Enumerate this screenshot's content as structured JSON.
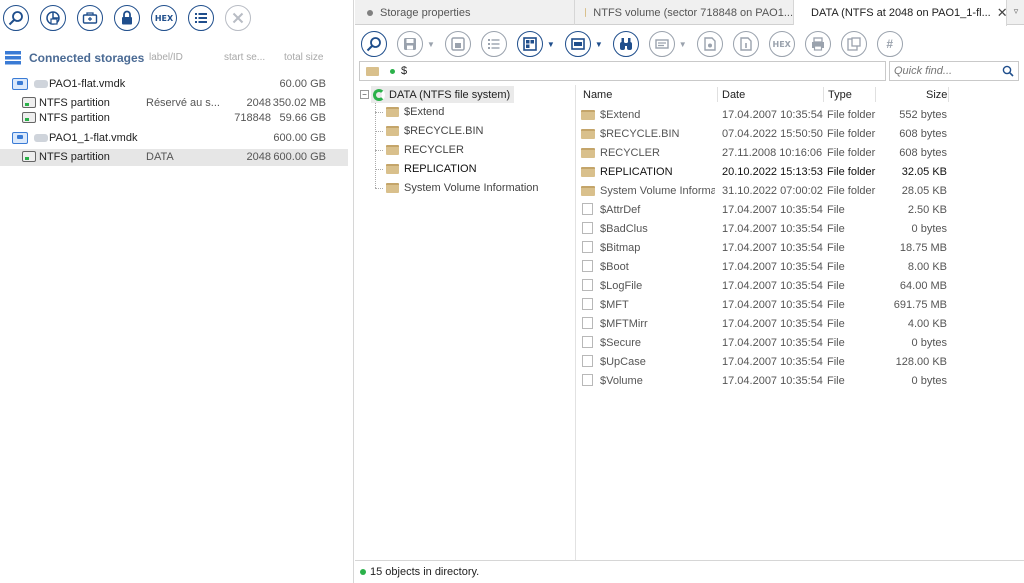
{
  "left": {
    "toolbar": [
      {
        "icon": "search-icon",
        "enabled": true
      },
      {
        "icon": "disk-refresh-icon",
        "enabled": true
      },
      {
        "icon": "image-file-icon",
        "enabled": true
      },
      {
        "icon": "lock-icon",
        "enabled": true
      },
      {
        "icon": "hex-icon",
        "label": "HEX",
        "enabled": true
      },
      {
        "icon": "list-icon",
        "enabled": true
      },
      {
        "icon": "close-icon",
        "enabled": false
      }
    ],
    "connected_storages": {
      "title": "Connected storages",
      "columns": {
        "label": "label/ID",
        "start": "start se...",
        "size": "total size"
      },
      "items": [
        {
          "kind": "disk",
          "name": "PAO1-flat.vmdk",
          "label": "",
          "start": "",
          "size": "60.00 GB",
          "selected": false
        },
        {
          "kind": "partition",
          "name": "NTFS partition",
          "label": "Réservé au s...",
          "start": "2048",
          "size": "350.02 MB",
          "selected": false
        },
        {
          "kind": "partition",
          "name": "NTFS partition",
          "label": "",
          "start": "718848",
          "size": "59.66 GB",
          "selected": false
        },
        {
          "kind": "disk",
          "name": "PAO1_1-flat.vmdk",
          "label": "",
          "start": "",
          "size": "600.00 GB",
          "selected": false
        },
        {
          "kind": "partition",
          "name": "NTFS partition",
          "label": "DATA",
          "start": "2048",
          "size": "600.00 GB",
          "selected": true
        }
      ]
    }
  },
  "tabs": [
    {
      "label": "Storage properties",
      "active": false
    },
    {
      "label": "NTFS volume (sector 718848 on PAO1...",
      "active": false
    },
    {
      "label": "DATA (NTFS at 2048 on PAO1_1-fl...",
      "active": true,
      "close": "✕"
    }
  ],
  "toolbar_right": [
    {
      "icon": "search-icon"
    },
    {
      "icon": "save-icon",
      "dropdown": true
    },
    {
      "icon": "save-selected-icon"
    },
    {
      "icon": "checklist-icon"
    },
    {
      "icon": "view-icon",
      "dropdown": true
    },
    {
      "icon": "panel-icon",
      "dropdown": true
    },
    {
      "icon": "binoculars-icon"
    },
    {
      "icon": "image-icon",
      "dropdown": true
    },
    {
      "icon": "file-settings-icon"
    },
    {
      "icon": "file-info-icon"
    },
    {
      "icon": "hex-icon",
      "label": "HEX"
    },
    {
      "icon": "print-icon"
    },
    {
      "icon": "properties-icon"
    },
    {
      "icon": "hash-icon",
      "label": "#"
    }
  ],
  "path": "$",
  "quick_find": {
    "placeholder": "Quick find..."
  },
  "tree": {
    "root": "DATA (NTFS file system)",
    "children": [
      {
        "name": "$Extend",
        "bold": false
      },
      {
        "name": "$RECYCLE.BIN",
        "bold": false
      },
      {
        "name": "RECYCLER",
        "bold": false
      },
      {
        "name": "REPLICATION",
        "bold": true
      },
      {
        "name": "System Volume Information",
        "bold": false
      }
    ]
  },
  "list": {
    "headers": {
      "name": "Name",
      "date": "Date",
      "type": "Type",
      "size": "Size"
    },
    "rows": [
      {
        "name": "$Extend",
        "date": "17.04.2007 10:35:54",
        "type": "File folder",
        "size": "552 bytes",
        "folder": true,
        "bold": false
      },
      {
        "name": "$RECYCLE.BIN",
        "date": "07.04.2022 15:50:50",
        "type": "File folder",
        "size": "608 bytes",
        "folder": true,
        "bold": false
      },
      {
        "name": "RECYCLER",
        "date": "27.11.2008 10:16:06",
        "type": "File folder",
        "size": "608 bytes",
        "folder": true,
        "bold": false
      },
      {
        "name": "REPLICATION",
        "date": "20.10.2022 15:13:53",
        "type": "File folder",
        "size": "32.05 KB",
        "folder": true,
        "bold": true
      },
      {
        "name": "System Volume Information",
        "date": "31.10.2022 07:00:02",
        "type": "File folder",
        "size": "28.05 KB",
        "folder": true,
        "bold": false
      },
      {
        "name": "$AttrDef",
        "date": "17.04.2007 10:35:54",
        "type": "File",
        "size": "2.50 KB",
        "folder": false,
        "bold": false
      },
      {
        "name": "$BadClus",
        "date": "17.04.2007 10:35:54",
        "type": "File",
        "size": "0 bytes",
        "folder": false,
        "bold": false
      },
      {
        "name": "$Bitmap",
        "date": "17.04.2007 10:35:54",
        "type": "File",
        "size": "18.75 MB",
        "folder": false,
        "bold": false
      },
      {
        "name": "$Boot",
        "date": "17.04.2007 10:35:54",
        "type": "File",
        "size": "8.00 KB",
        "folder": false,
        "bold": false
      },
      {
        "name": "$LogFile",
        "date": "17.04.2007 10:35:54",
        "type": "File",
        "size": "64.00 MB",
        "folder": false,
        "bold": false
      },
      {
        "name": "$MFT",
        "date": "17.04.2007 10:35:54",
        "type": "File",
        "size": "691.75 MB",
        "folder": false,
        "bold": false
      },
      {
        "name": "$MFTMirr",
        "date": "17.04.2007 10:35:54",
        "type": "File",
        "size": "4.00 KB",
        "folder": false,
        "bold": false
      },
      {
        "name": "$Secure",
        "date": "17.04.2007 10:35:54",
        "type": "File",
        "size": "0 bytes",
        "folder": false,
        "bold": false
      },
      {
        "name": "$UpCase",
        "date": "17.04.2007 10:35:54",
        "type": "File",
        "size": "128.00 KB",
        "folder": false,
        "bold": false
      },
      {
        "name": "$Volume",
        "date": "17.04.2007 10:35:54",
        "type": "File",
        "size": "0 bytes",
        "folder": false,
        "bold": false
      }
    ]
  },
  "status": {
    "text": "15 objects in directory."
  },
  "colors": {
    "accent": "#1f4e8c",
    "ok": "#2bb14a",
    "folder": "#d9c08c",
    "selection": "#e6e6e6"
  }
}
